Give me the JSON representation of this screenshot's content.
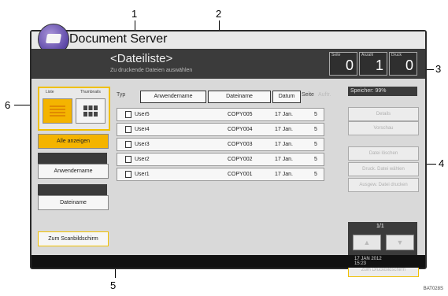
{
  "app": {
    "title": "Document Server",
    "list_title": "<Dateiliste>",
    "list_subtitle": "Zu druckende Dateien auswählen"
  },
  "counters": [
    {
      "label": "Seite",
      "value": "0"
    },
    {
      "label": "Anzahl",
      "value": "1"
    },
    {
      "label": "Druck",
      "value": "0"
    }
  ],
  "view": {
    "list_label": "Liste",
    "thumb_label": "Thumbnails"
  },
  "left_buttons": {
    "show_all": "Alle anzeigen",
    "user_name": "Anwendername",
    "file_name": "Dateiname",
    "to_scan": "Zum Scanbildschirm"
  },
  "table": {
    "type_label": "Typ",
    "headers": [
      "Anwendername",
      "Dateiname",
      "Datum",
      "Seite",
      "Auftr."
    ],
    "rows": [
      {
        "user": "User5",
        "file": "COPY005",
        "date": "17 Jan.",
        "pages": "5"
      },
      {
        "user": "User4",
        "file": "COPY004",
        "date": "17 Jan.",
        "pages": "5"
      },
      {
        "user": "User3",
        "file": "COPY003",
        "date": "17 Jan.",
        "pages": "5"
      },
      {
        "user": "User2",
        "file": "COPY002",
        "date": "17 Jan.",
        "pages": "5"
      },
      {
        "user": "User1",
        "file": "COPY001",
        "date": "17 Jan.",
        "pages": "5"
      }
    ]
  },
  "right": {
    "memory": "Speicher: 99%",
    "details": "Details",
    "preview": "Vorschau",
    "delete_file": "Datei löschen",
    "print": "Druck. Datei wählen",
    "print_spec": "Ausgew. Datei drucken",
    "page": "1/1",
    "up": "▲",
    "down": "▼",
    "to_print": "Zum Druckbildschirm"
  },
  "datetime": {
    "date": "17 JAN  2012",
    "time": "15:23"
  },
  "callouts": [
    "1",
    "2",
    "3",
    "4",
    "5",
    "6"
  ],
  "image_code": "BAT028S"
}
